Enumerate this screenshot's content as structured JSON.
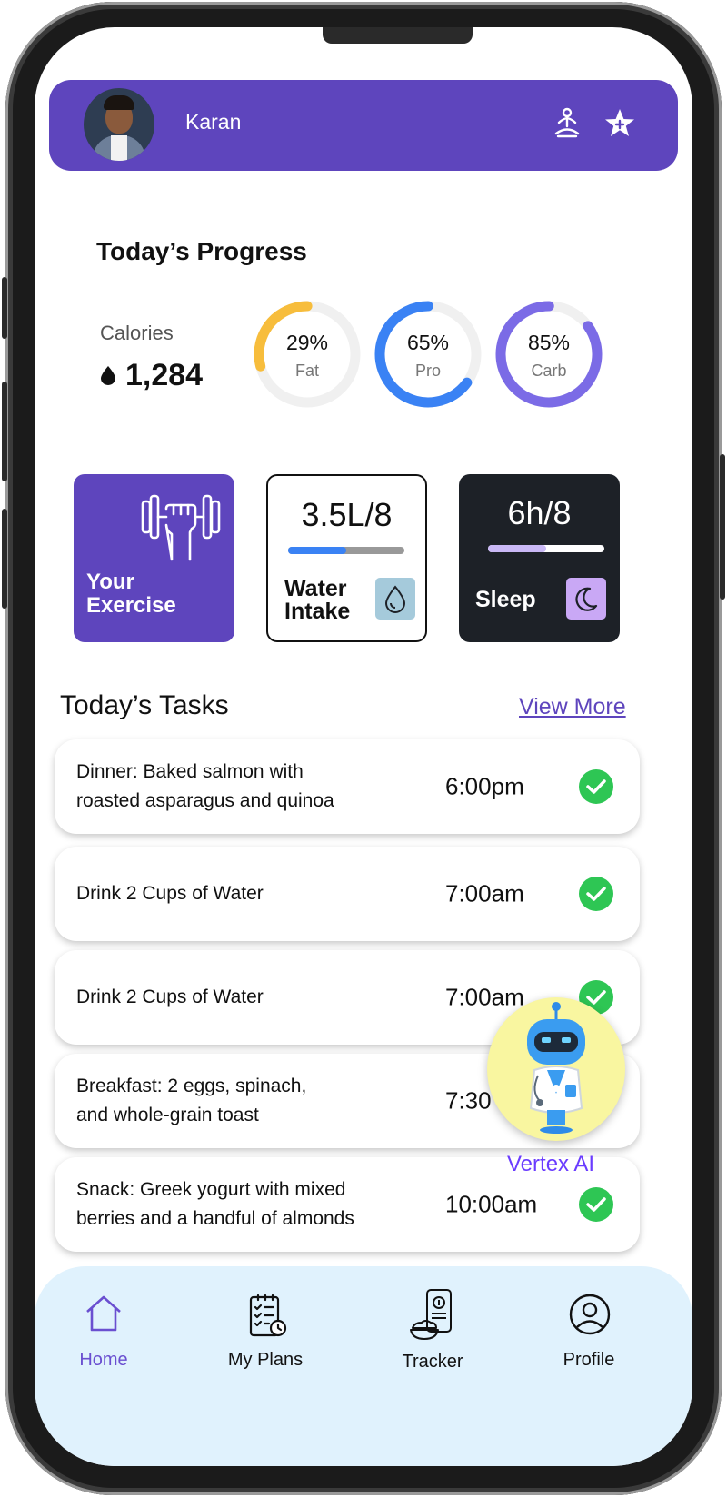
{
  "header": {
    "user_name": "Karan",
    "icons": [
      "meditation-icon",
      "star-icon"
    ],
    "accent": "#5e45bd"
  },
  "progress": {
    "title": "Today’s Progress",
    "calories_label": "Calories",
    "calories_value": "1,284",
    "rings": [
      {
        "pct_text": "29%",
        "label": "Fat",
        "value": 29,
        "color": "#f7bd3c"
      },
      {
        "pct_text": "65%",
        "label": "Pro",
        "value": 65,
        "color": "#3a82f4"
      },
      {
        "pct_text": "85%",
        "label": "Carb",
        "value": 85,
        "color": "#7b6be6"
      }
    ]
  },
  "cards": {
    "exercise": {
      "line1": "Your",
      "line2": "Exercise"
    },
    "water": {
      "value": "3.5L/8",
      "line1": "Water",
      "line2": "Intake",
      "fill_fraction": 0.5,
      "icon": "water-drop-icon"
    },
    "sleep": {
      "value": "6h/8",
      "label": "Sleep",
      "fill_fraction": 0.5,
      "icon": "moon-icon"
    }
  },
  "tasks": {
    "title": "Today’s Tasks",
    "view_more": "View More",
    "items": [
      {
        "line1": "Dinner: Baked salmon with",
        "line2": "roasted asparagus and quinoa",
        "time": "6:00pm"
      },
      {
        "line1": "Drink 2 Cups of Water",
        "line2": "",
        "time": "7:00am"
      },
      {
        "line1": "Drink 2 Cups of Water",
        "line2": "",
        "time": "7:00am"
      },
      {
        "line1": "Breakfast: 2 eggs, spinach,",
        "line2": "and whole-grain toast",
        "time": "7:30"
      },
      {
        "line1": "Snack: Greek yogurt with mixed",
        "line2": "berries and a handful of almonds",
        "time": "10:00am"
      }
    ]
  },
  "assistant": {
    "label": "Vertex AI"
  },
  "nav": [
    {
      "label": "Home",
      "icon": "home-icon",
      "active": true
    },
    {
      "label": "My Plans",
      "icon": "checklist-icon"
    },
    {
      "label": "Tracker",
      "icon": "phone-tracker-icon"
    },
    {
      "label": "Profile",
      "icon": "profile-icon"
    }
  ]
}
